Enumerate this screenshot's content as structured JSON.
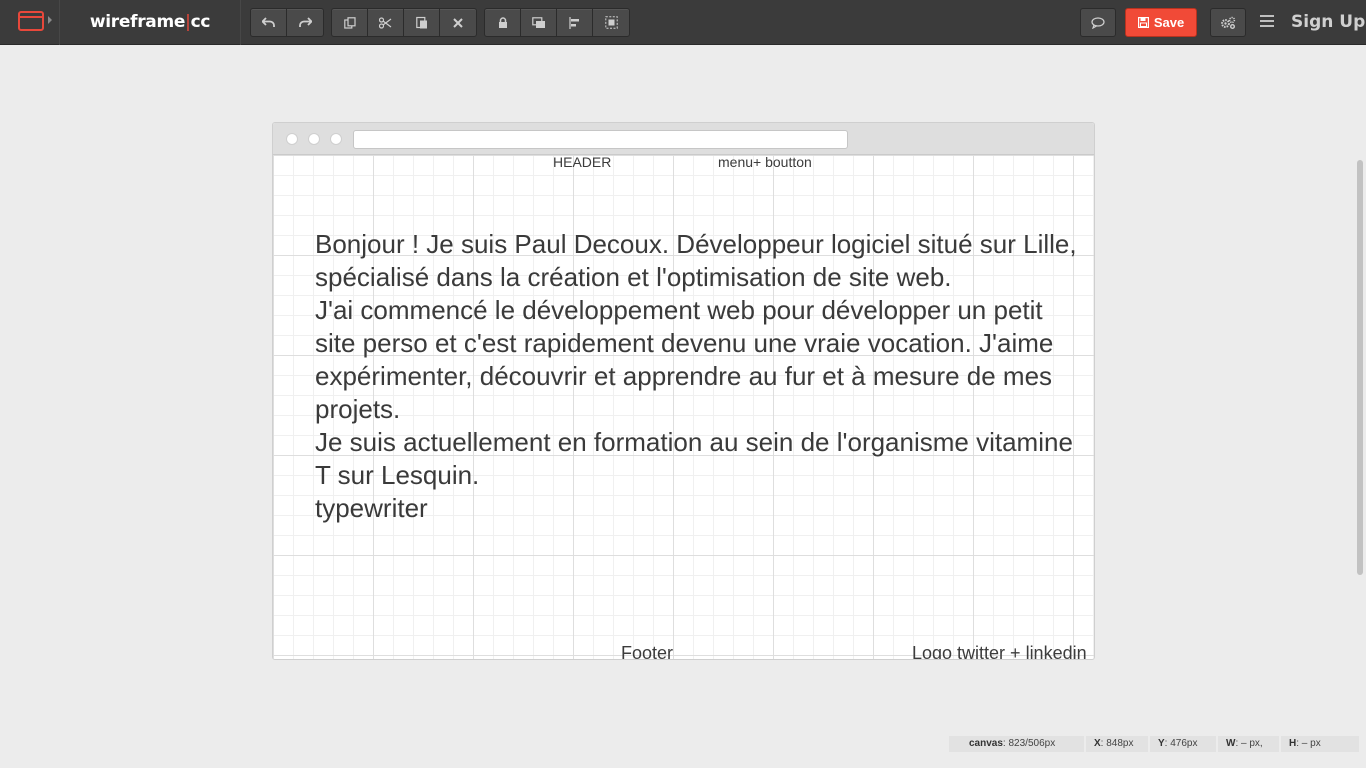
{
  "app": {
    "brand_left": "wireframe",
    "brand_sep": "|",
    "brand_right": "cc"
  },
  "toolbar": {
    "history": [
      {
        "name": "undo-icon"
      },
      {
        "name": "redo-icon"
      }
    ],
    "edit": [
      {
        "name": "copy-icon"
      },
      {
        "name": "cut-icon"
      },
      {
        "name": "paste-icon"
      },
      {
        "name": "delete-icon"
      }
    ],
    "arrange": [
      {
        "name": "lock-icon"
      },
      {
        "name": "bring-front-icon"
      },
      {
        "name": "align-icon"
      },
      {
        "name": "group-icon"
      }
    ],
    "save_label": "Save",
    "signup_label": "Sign Up",
    "accent": "#f14a37"
  },
  "canvas": {
    "header_label": "HEADER",
    "menu_label": "menu+ boutton",
    "paragraphs": [
      "Bonjour ! Je suis Paul Decoux. Développeur logiciel situé sur Lille, spécialisé dans la création et l'optimisation de site web.",
      "J'ai commencé le développement web pour développer un petit site perso et c'est rapidement devenu une vraie vocation. J'aime expérimenter, découvrir et apprendre au fur et à mesure de mes projets.",
      "Je suis actuellement en formation au sein de l'organisme vitamine T sur Lesquin.",
      "typewriter"
    ],
    "footer_label": "Footer",
    "social_label": "Logo twitter + linkedin"
  },
  "status": {
    "canvas_label": "canvas",
    "canvas_value": "823/506px",
    "x_label": "X",
    "x_value": "848px",
    "y_label": "Y",
    "y_value": "476px",
    "w_label": "W",
    "w_value": "– px,",
    "h_label": "H",
    "h_value": "– px"
  }
}
